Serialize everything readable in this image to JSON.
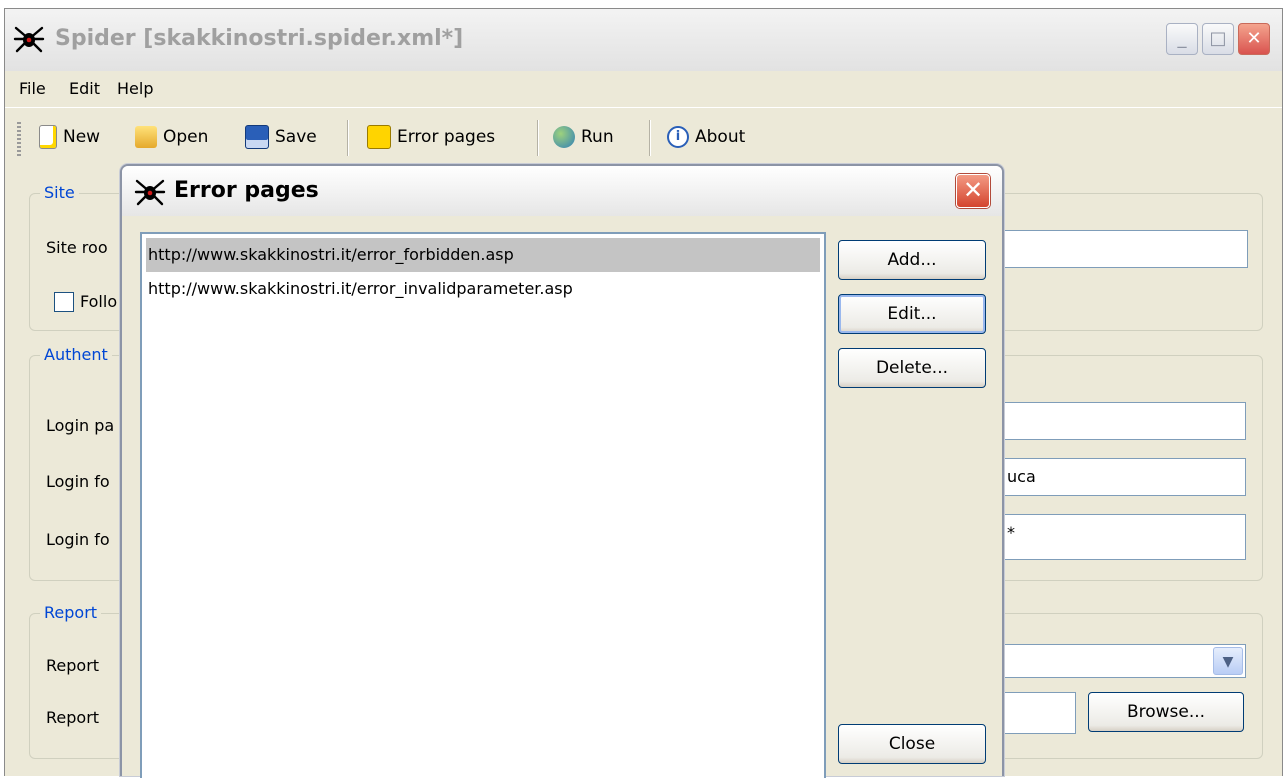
{
  "window": {
    "title": "Spider [skakkinostri.spider.xml*]",
    "controls": {
      "minimize": "_",
      "maximize": "□",
      "close": "✕"
    }
  },
  "menu": [
    "File",
    "Edit",
    "Help"
  ],
  "toolbar": {
    "new": "New",
    "open": "Open",
    "save": "Save",
    "error_pages": "Error pages",
    "run": "Run",
    "about": "About"
  },
  "main": {
    "site": {
      "legend": "Site",
      "site_root_label": "Site roo",
      "follow_label": "Follo"
    },
    "authentication": {
      "legend": "Authent",
      "login_page_label": "Login pa",
      "login_form_label_1": "Login fo",
      "login_form_label_2": "Login fo",
      "username_value": "uca",
      "password_value": "*"
    },
    "report": {
      "legend": "Report",
      "report_label_1": "Report",
      "report_label_2": "Report",
      "browse_button": "Browse..."
    }
  },
  "dialog": {
    "title": "Error pages",
    "close_glyph": "✕",
    "items": [
      {
        "url": "http://www.skakkinostri.it/error_forbidden.asp",
        "selected": true
      },
      {
        "url": "http://www.skakkinostri.it/error_invalidparameter.asp",
        "selected": false
      }
    ],
    "buttons": {
      "add": "Add...",
      "edit": "Edit...",
      "delete": "Delete...",
      "close": "Close"
    }
  },
  "colors": {
    "window_bg": "#ece9d8",
    "legend_blue": "#0046d5",
    "selection_gray": "#c4c4c4",
    "close_red": "#d4442e"
  }
}
